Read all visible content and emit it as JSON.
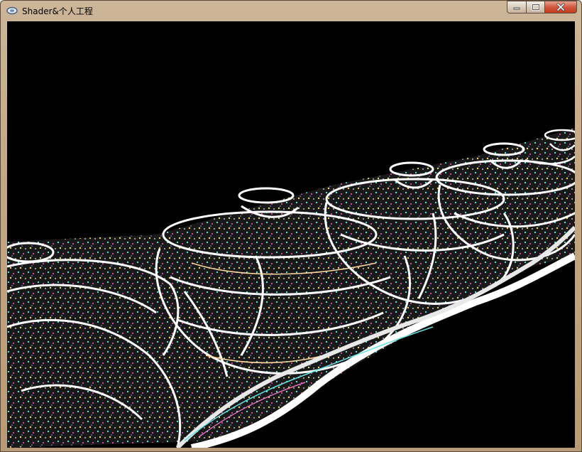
{
  "window": {
    "title": "Shader&个人工程",
    "icon": "app-icon",
    "buttons": {
      "minimize": "minimize-icon",
      "maximize": "maximize-icon",
      "close": "close-icon"
    }
  },
  "scene": {
    "description_icon": "render-viewport",
    "background": "#000000"
  }
}
